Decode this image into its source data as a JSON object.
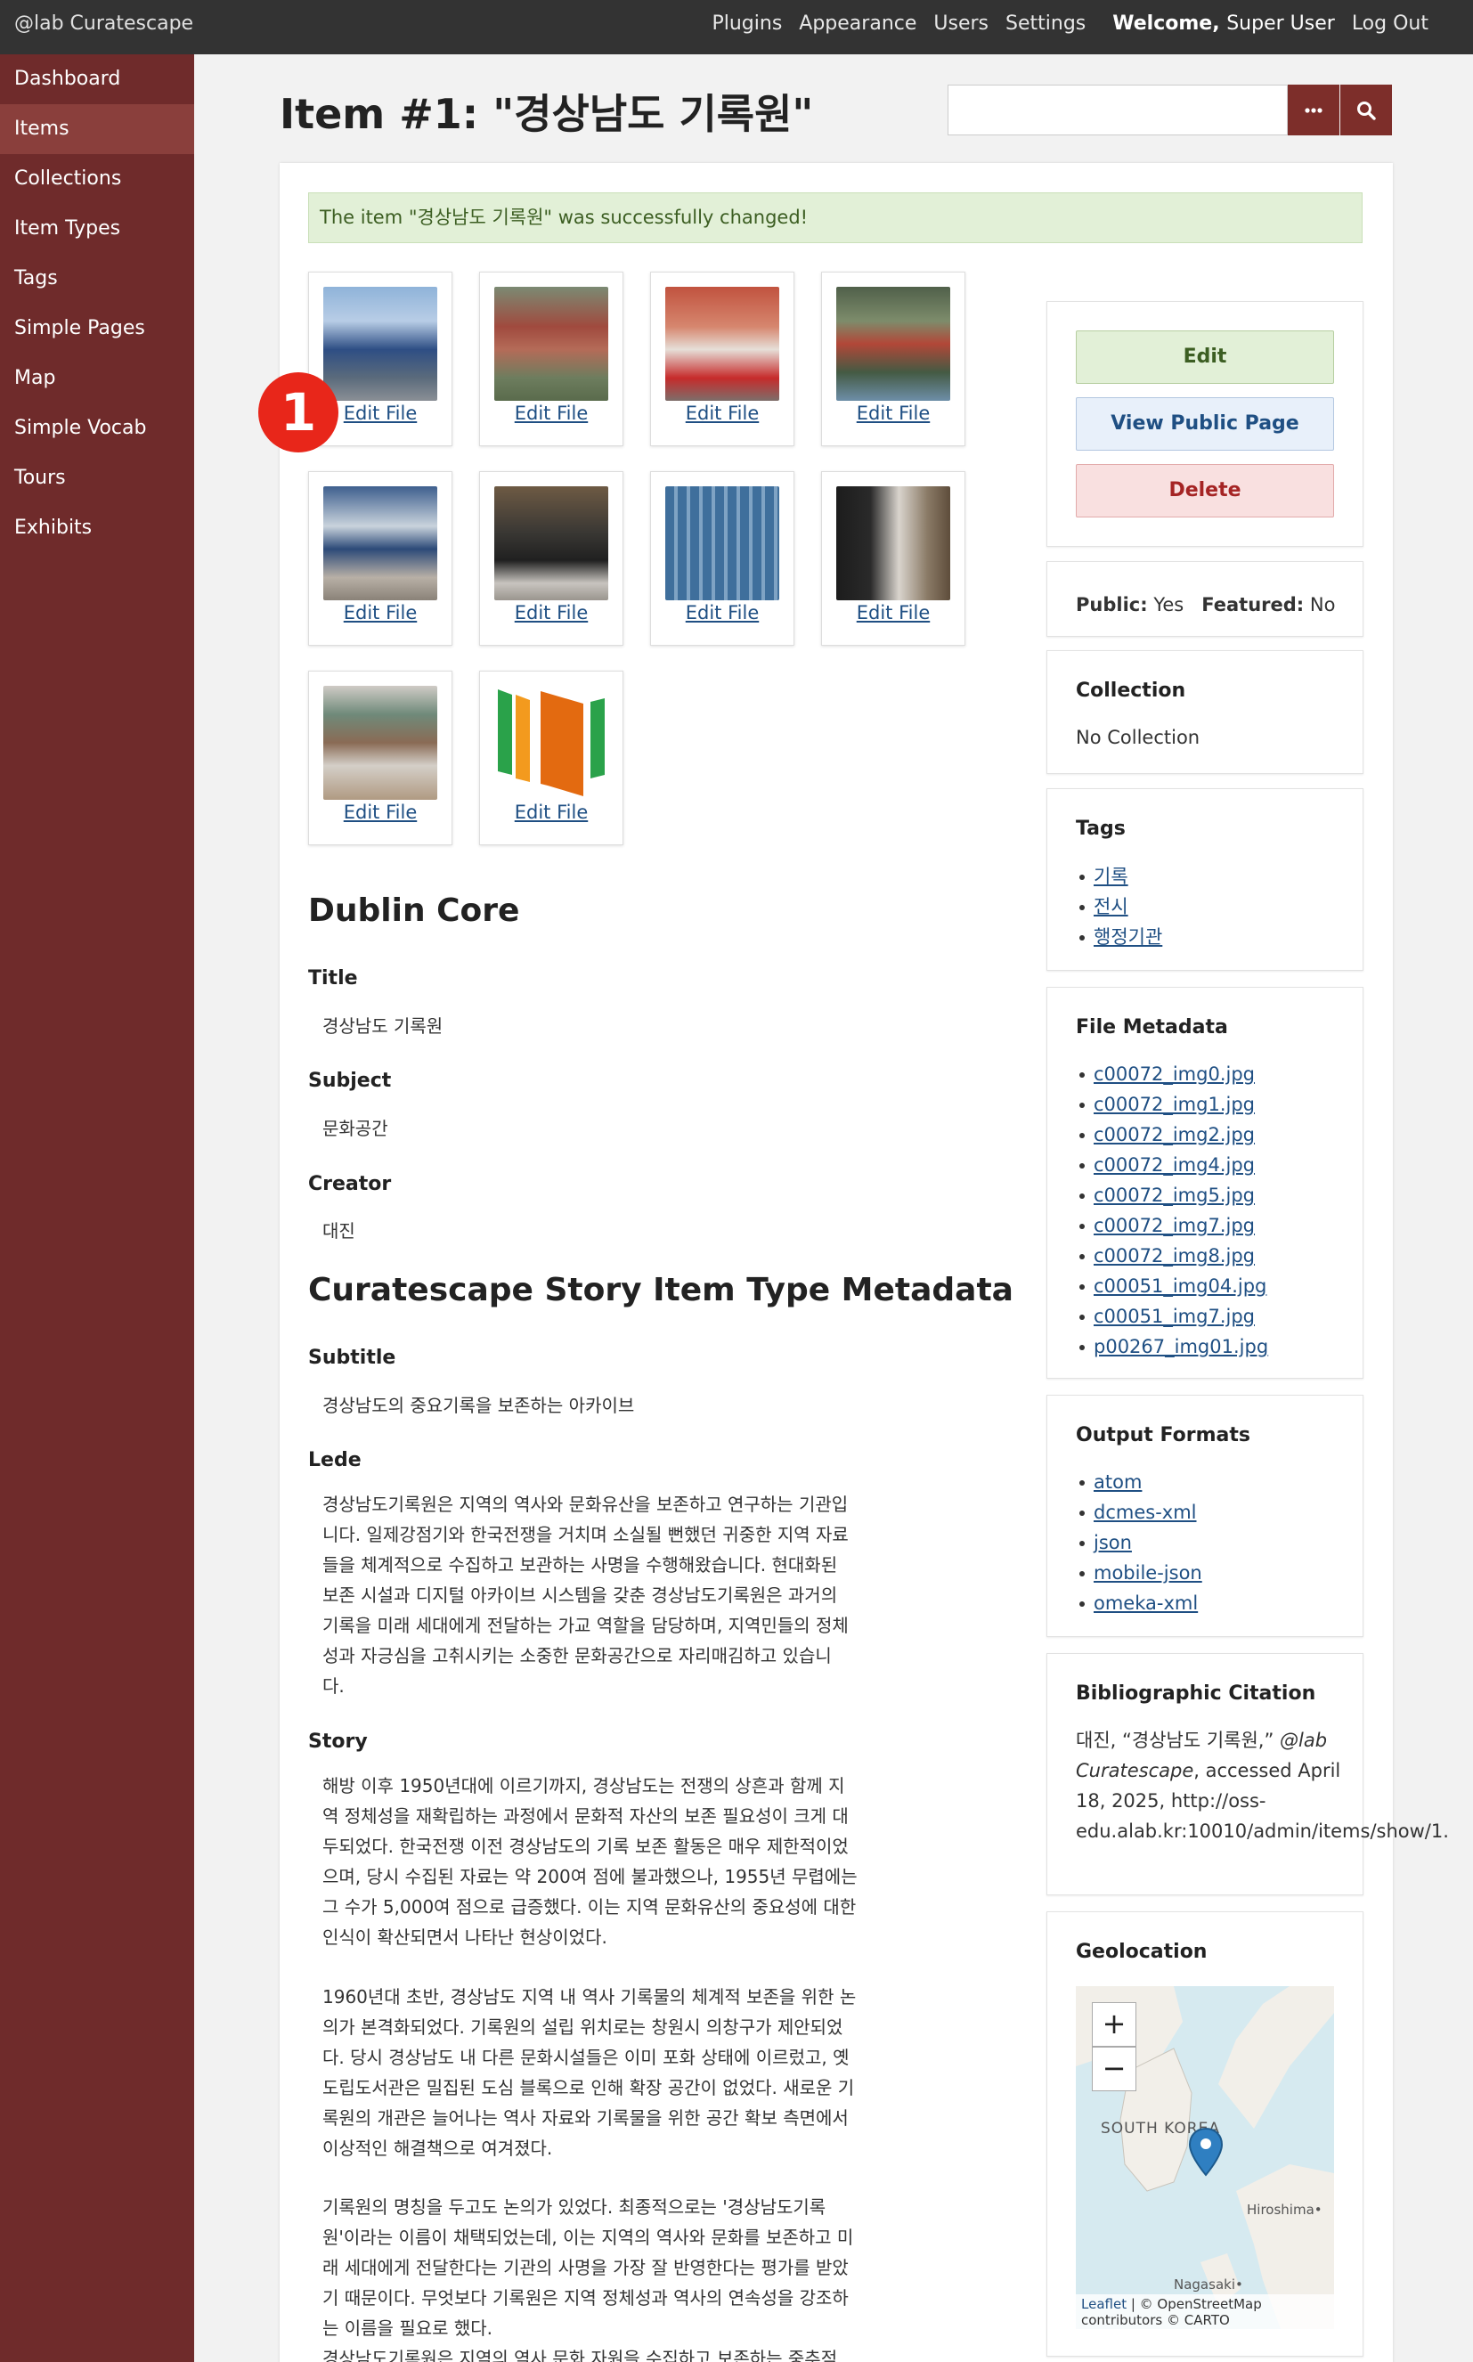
{
  "header": {
    "site_title": "@lab Curatescape",
    "nav": [
      "Plugins",
      "Appearance",
      "Users",
      "Settings"
    ],
    "welcome_prefix": "Welcome, ",
    "welcome_user": "Super User",
    "logout": "Log Out"
  },
  "sidebar": {
    "items": [
      {
        "label": "Dashboard",
        "active": false
      },
      {
        "label": "Items",
        "active": true
      },
      {
        "label": "Collections",
        "active": false
      },
      {
        "label": "Item Types",
        "active": false
      },
      {
        "label": "Tags",
        "active": false
      },
      {
        "label": "Simple Pages",
        "active": false
      },
      {
        "label": "Map",
        "active": false
      },
      {
        "label": "Simple Vocab",
        "active": false
      },
      {
        "label": "Tours",
        "active": false
      },
      {
        "label": "Exhibits",
        "active": false
      }
    ]
  },
  "page": {
    "title": "Item #1: \"경상남도 기록원\"",
    "search_placeholder": "",
    "more_icon": "ellipsis-icon",
    "search_icon": "magnifier-icon",
    "flash": "The item \"경상남도 기록원\" was successfully changed!",
    "badge": "1"
  },
  "files": {
    "edit_label": "Edit File",
    "count": 10
  },
  "dublin_core": {
    "heading": "Dublin Core",
    "title_label": "Title",
    "title_value": "경상남도 기록원",
    "subject_label": "Subject",
    "subject_value": "문화공간",
    "creator_label": "Creator",
    "creator_value": "대진"
  },
  "story_meta": {
    "heading": "Curatescape Story Item Type Metadata",
    "subtitle_label": "Subtitle",
    "subtitle_value": "경상남도의 중요기록을 보존하는 아카이브",
    "lede_label": "Lede",
    "lede_lines": [
      "경상남도기록원은 지역의 역사와 문화유산을 보존하고 연구하는 기관입",
      "니다. 일제강점기와 한국전쟁을 거치며 소실될 뻔했던 귀중한 지역 자료",
      "들을 체계적으로 수집하고 보관하는 사명을 수행해왔습니다. 현대화된",
      "보존 시설과 디지털 아카이브 시스템을 갖춘 경상남도기록원은 과거의",
      "기록을 미래 세대에게 전달하는 가교 역할을 담당하며, 지역민들의 정체",
      "성과 자긍심을 고취시키는 소중한 문화공간으로 자리매김하고 있습니",
      "다."
    ],
    "story_label": "Story",
    "story_p1": [
      "해방 이후 1950년대에 이르기까지, 경상남도는 전쟁의 상흔과 함께 지",
      "역 정체성을 재확립하는 과정에서 문화적 자산의 보존 필요성이 크게 대",
      "두되었다. 한국전쟁 이전 경상남도의 기록 보존 활동은 매우 제한적이었",
      "으며, 당시 수집된 자료는 약 200여 점에 불과했으나, 1955년 무렵에는",
      "그 수가 5,000여 점으로 급증했다. 이는 지역 문화유산의 중요성에 대한",
      "인식이 확산되면서 나타난 현상이었다."
    ],
    "story_p2": [
      "1960년대 초반, 경상남도 지역 내 역사 기록물의 체계적 보존을 위한 논",
      "의가 본격화되었다. 기록원의 설립 위치로는 창원시 의창구가 제안되었",
      "다. 당시 경상남도 내 다른 문화시설들은 이미 포화 상태에 이르렀고, 옛",
      "도립도서관은 밀집된 도심 블록으로 인해 확장 공간이 없었다. 새로운 기",
      "록원의 개관은 늘어나는 역사 자료와 기록물을 위한 공간 확보 측면에서",
      "이상적인 해결책으로 여겨졌다."
    ],
    "story_p3": [
      "기록원의 명칭을 두고도 논의가 있었다. 최종적으로는 '경상남도기록",
      "원'이라는 이름이 채택되었는데, 이는 지역의 역사와 문화를 보존하고 미",
      "래 세대에게 전달한다는 기관의 사명을 가장 잘 반영한다는 평가를 받았",
      "기 때문이다. 무엇보다 기록원은 지역 정체성과 역사의 연속성을 강조하",
      "는 이름을 필요로 했다.",
      "경상남도기록원은 지역의 역사 문화 자원을 수집하고 보존하는 중추적"
    ]
  },
  "actions": {
    "edit": "Edit",
    "view_public": "View Public Page",
    "delete": "Delete"
  },
  "status": {
    "public_label": "Public:",
    "public_value": "Yes",
    "featured_label": "Featured:",
    "featured_value": "No"
  },
  "collection": {
    "title": "Collection",
    "value": "No Collection"
  },
  "tags": {
    "title": "Tags",
    "items": [
      "기록",
      "전시",
      "행정기관"
    ]
  },
  "file_metadata": {
    "title": "File Metadata",
    "items": [
      "c00072_img0.jpg",
      "c00072_img1.jpg",
      "c00072_img2.jpg",
      "c00072_img4.jpg",
      "c00072_img5.jpg",
      "c00072_img7.jpg",
      "c00072_img8.jpg",
      "c00051_img04.jpg",
      "c00051_img7.jpg",
      "p00267_img01.jpg"
    ]
  },
  "output_formats": {
    "title": "Output Formats",
    "items": [
      "atom",
      "dcmes-xml",
      "json",
      "mobile-json",
      "omeka-xml"
    ]
  },
  "citation": {
    "title": "Bibliographic Citation",
    "prefix": "대진, “경상남도 기록원,” ",
    "site": "@lab Curatescape",
    "suffix": ", accessed April 18, 2025, http://oss-edu.alab.kr:10010/admin/items/show/1."
  },
  "geolocation": {
    "title": "Geolocation",
    "zoom_in": "+",
    "zoom_out": "−",
    "label_korea": "SOUTH KOREA",
    "label_hiroshima": "Hiroshima•",
    "label_nagasaki": "Nagasaki•",
    "attribution_leaflet": "Leaflet",
    "attribution_rest": " | © OpenStreetMap",
    "attribution_line2": "contributors © CARTO"
  }
}
